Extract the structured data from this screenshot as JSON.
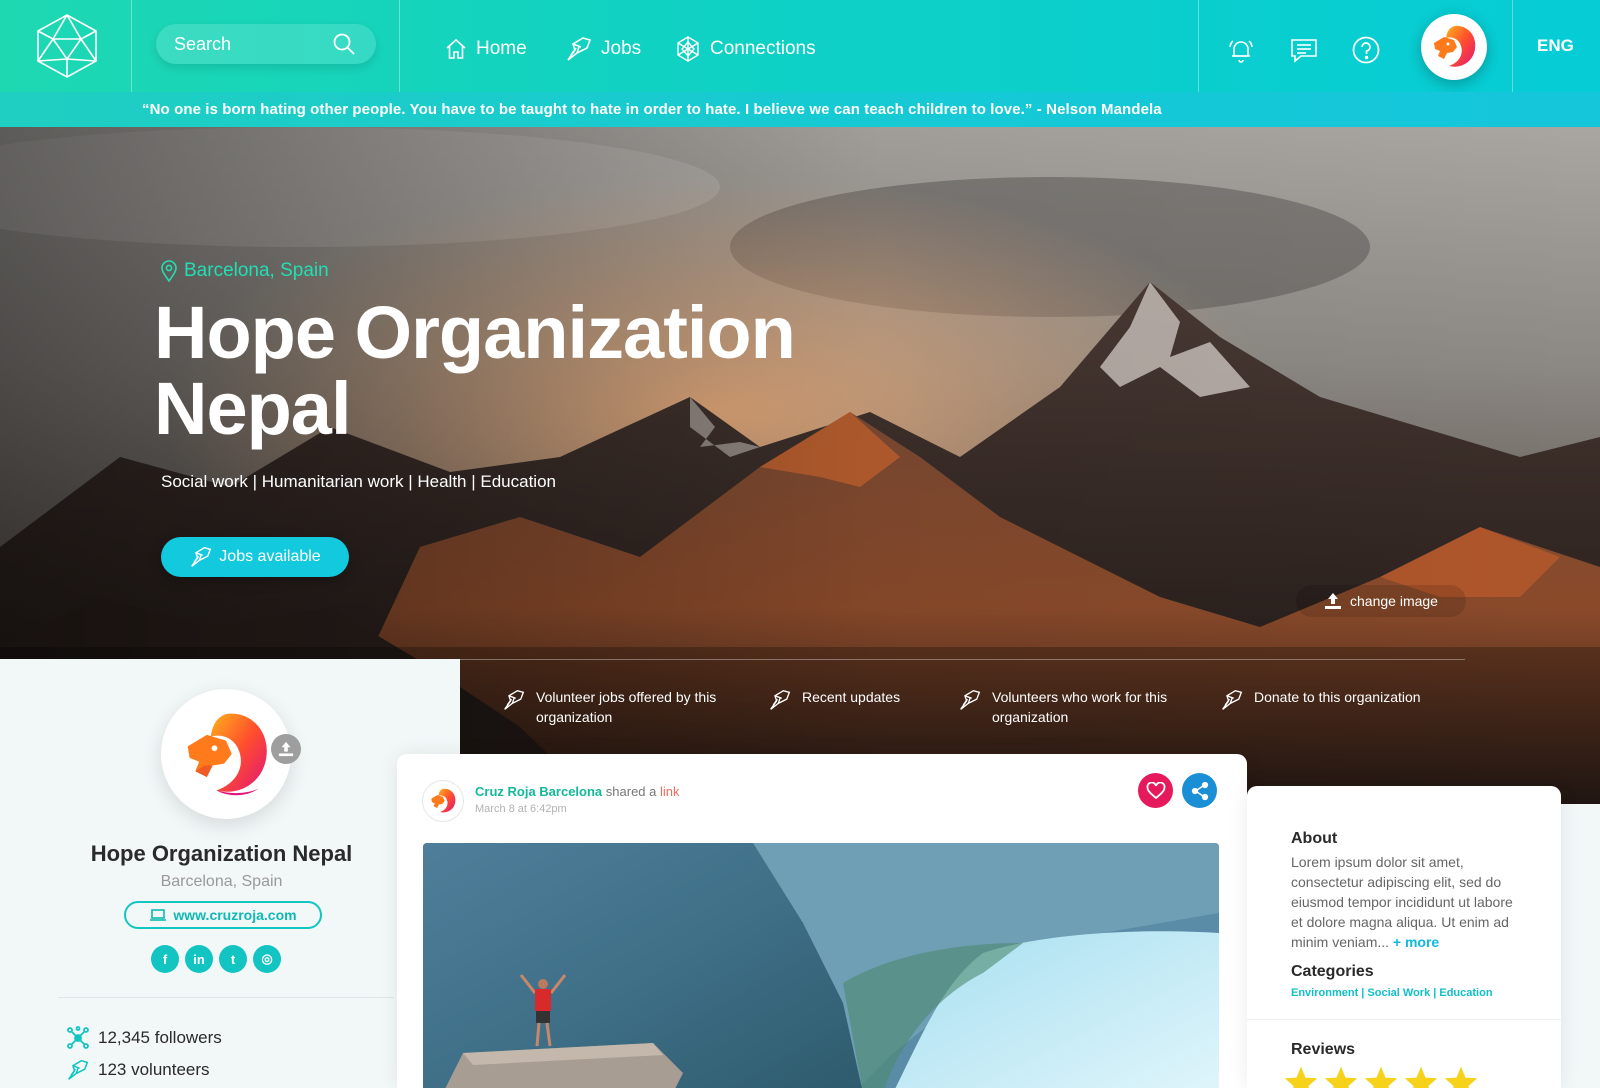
{
  "search": {
    "placeholder": "Search"
  },
  "nav": {
    "items": [
      {
        "label": "Home",
        "icon": "home-icon"
      },
      {
        "label": "Jobs",
        "icon": "jobs-icon"
      },
      {
        "label": "Connections",
        "icon": "connections-icon"
      }
    ],
    "actions": [
      "bell-icon",
      "chat-icon",
      "help-icon"
    ],
    "language": "ENG"
  },
  "quote": "“No one is born hating other people. You have to be taught to hate in order to hate. I believe we can teach children to love.” - Nelson Mandela",
  "hero": {
    "location": "Barcelona, Spain",
    "title_line1": "Hope Organization",
    "title_line2": "Nepal",
    "subtitle": "Social work | Humanitarian work | Health | Education",
    "jobs_button": "Jobs available",
    "change_image": "change image"
  },
  "tabs": [
    {
      "label_line1": "Volunteer jobs offered by this",
      "label_line2": "organization"
    },
    {
      "label_line1": "Recent updates",
      "label_line2": ""
    },
    {
      "label_line1": "Volunteers who work for this",
      "label_line2": "organization"
    },
    {
      "label_line1": "Donate to this organization",
      "label_line2": ""
    }
  ],
  "profile": {
    "name": "Hope Organization Nepal",
    "location": "Barcelona, Spain",
    "website": "www.cruzroja.com",
    "socials": [
      {
        "name": "facebook",
        "glyph": "f"
      },
      {
        "name": "linkedin",
        "glyph": "in"
      },
      {
        "name": "twitter",
        "glyph": "t"
      },
      {
        "name": "instagram",
        "glyph": "◎"
      }
    ],
    "followers": "12,345 followers",
    "volunteers": "123 volunteers"
  },
  "post": {
    "author": "Cruz Roja Barcelona",
    "action": "shared a",
    "link_text": "link",
    "date": "March 8 at 6:42pm"
  },
  "info": {
    "about_title": "About",
    "about_text": "Lorem ipsum dolor sit amet, consectetur adipiscing elit, sed do eiusmod tempor incididunt ut labore et dolore magna aliqua. Ut enim ad minim veniam...",
    "more": "+ more",
    "categories_title": "Categories",
    "categories": "Environment | Social Work | Education",
    "reviews_title": "Reviews",
    "rating": 5,
    "rating_max": 5
  },
  "colors": {
    "accent": "#12c9dd",
    "green": "#21dfb3",
    "like": "#e6195c",
    "share": "#1b8fd6",
    "star": "#f6d31a"
  }
}
